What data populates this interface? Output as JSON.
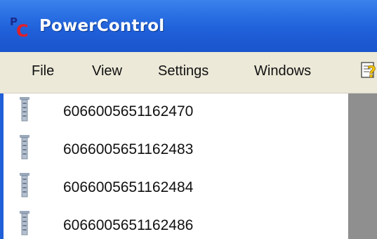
{
  "window": {
    "title": "PowerControl"
  },
  "menu": {
    "items": [
      {
        "label": "File"
      },
      {
        "label": "View"
      },
      {
        "label": "Settings"
      },
      {
        "label": "Windows"
      }
    ]
  },
  "devices": {
    "items": [
      {
        "id": "6066005651162470"
      },
      {
        "id": "6066005651162483"
      },
      {
        "id": "6066005651162484"
      },
      {
        "id": "6066005651162486"
      }
    ]
  },
  "icons": {
    "app_logo": "pc-logo-icon",
    "help": "help-question-icon",
    "device": "device-battery-icon"
  },
  "colors": {
    "titlebar": "#1f5fd8",
    "menubar": "#ece9d8",
    "logo_red": "#e0202a",
    "side_panel": "#8f8f8f"
  }
}
